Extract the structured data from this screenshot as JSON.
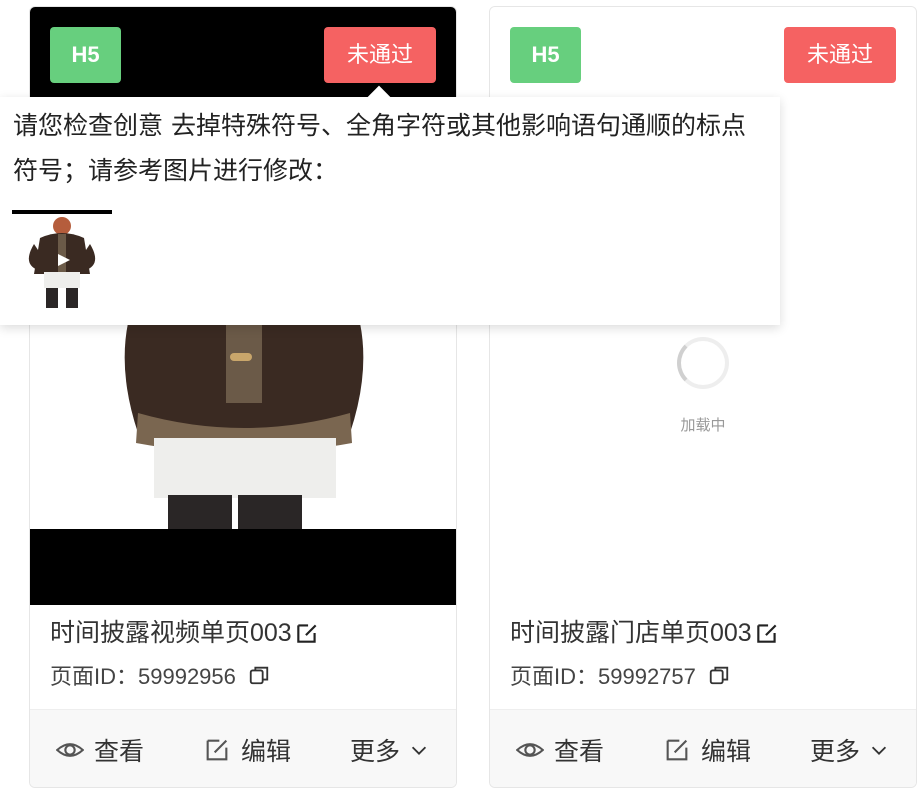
{
  "cards": [
    {
      "tag_type": "H5",
      "tag_status": "未通过",
      "title": "时间披露视频单页003",
      "page_id": "页面ID：59992956",
      "actions": {
        "view": "查看",
        "edit": "编辑",
        "more": "更多"
      }
    },
    {
      "tag_type": "H5",
      "tag_status": "未通过",
      "loading_text": "加载中",
      "title": "时间披露门店单页003",
      "page_id": "页面ID：59992757",
      "actions": {
        "view": "查看",
        "edit": "编辑",
        "more": "更多"
      }
    }
  ],
  "popover": {
    "message": "请您检查创意 去掉特殊符号、全角字符或其他影响语句通顺的标点符号；请参考图片进行修改："
  },
  "colors": {
    "h5_tag": "#67cf7e",
    "fail_tag": "#f56262",
    "action_bar": "#f8f8f8"
  },
  "icons": [
    "eye-icon",
    "edit-icon",
    "chevron-down-icon",
    "copy-icon",
    "spinner-icon"
  ]
}
